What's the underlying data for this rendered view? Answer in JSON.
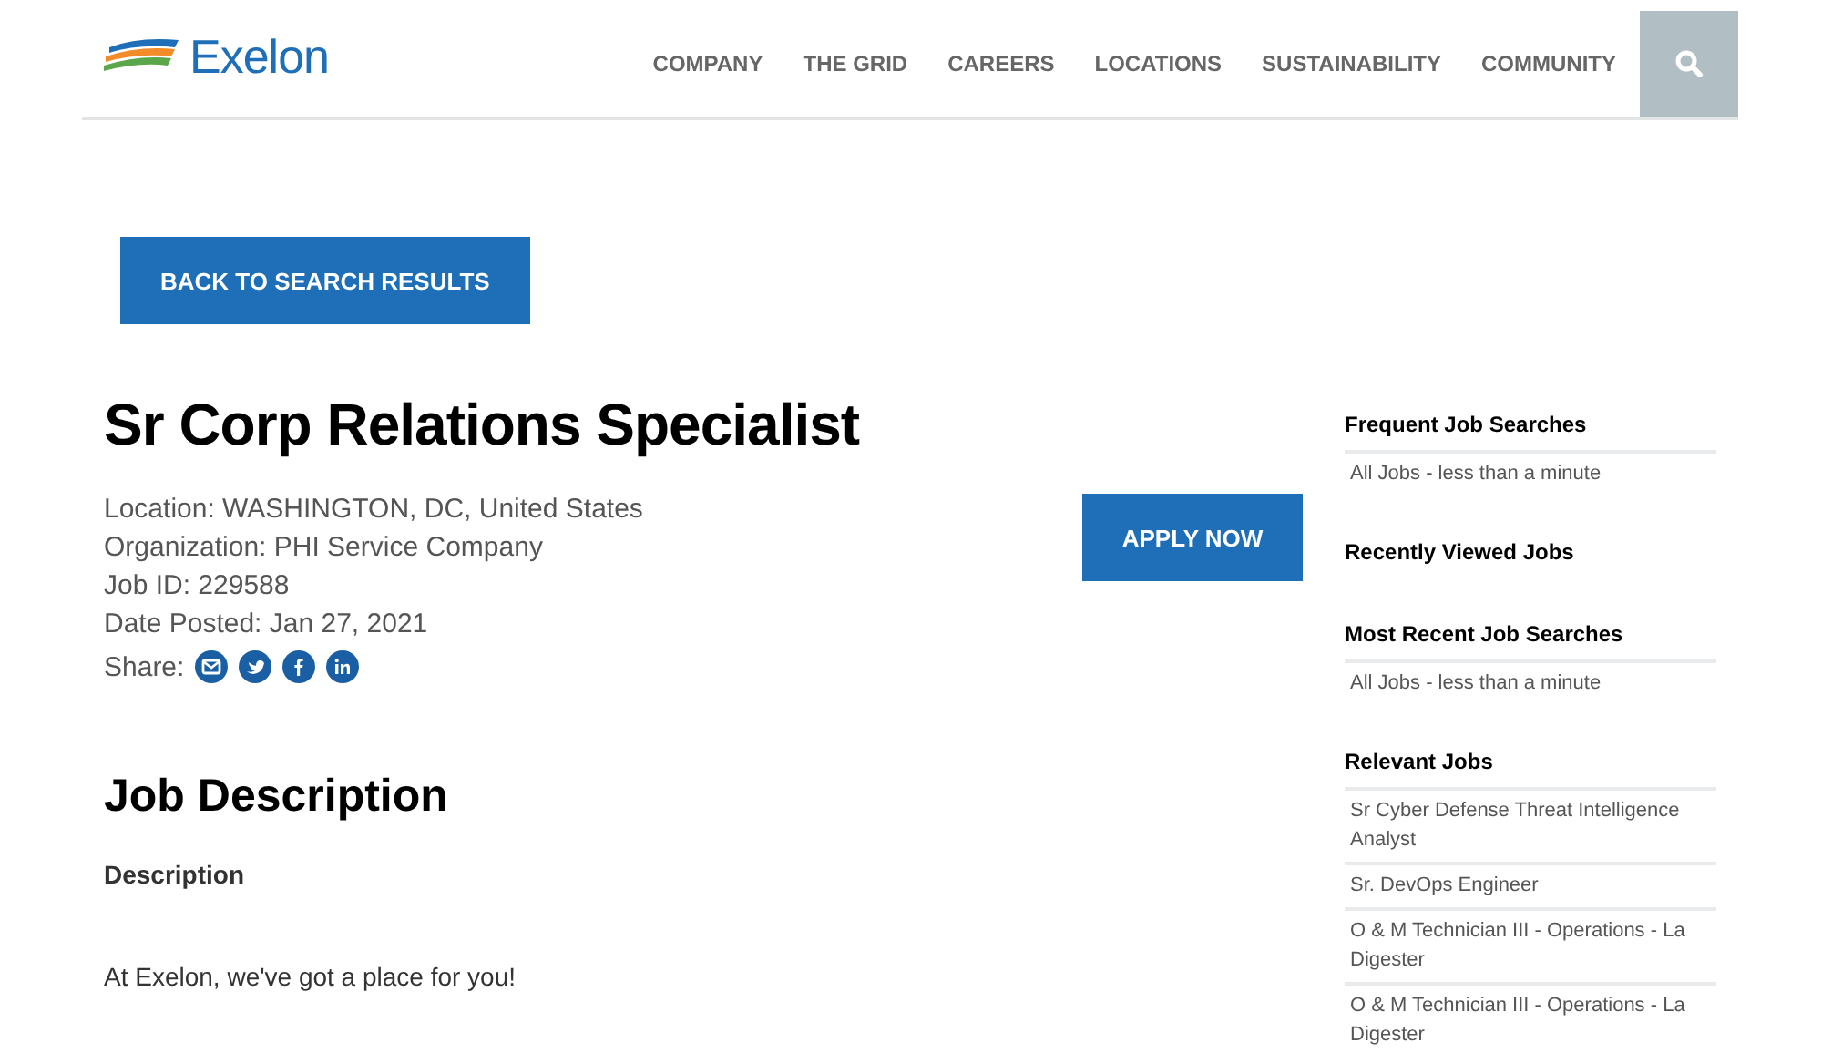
{
  "header": {
    "logo": "Exelon",
    "nav": [
      "COMPANY",
      "THE GRID",
      "CAREERS",
      "LOCATIONS",
      "SUSTAINABILITY",
      "COMMUNITY"
    ]
  },
  "back_button": "BACK TO SEARCH RESULTS",
  "job": {
    "title": "Sr Corp Relations Specialist",
    "details": [
      "Location: WASHINGTON, DC, United States",
      "Organization: PHI Service Company",
      "Job ID: 229588",
      "Date Posted: Jan 27, 2021"
    ],
    "share_label": "Share:",
    "share": [
      {
        "kind": "email"
      },
      {
        "kind": "twitter"
      },
      {
        "kind": "facebook"
      },
      {
        "kind": "linkedin"
      }
    ],
    "apply_button": "APPLY NOW"
  },
  "description": {
    "heading": "Job Description",
    "subheading": "Description",
    "text": "At Exelon, we've got a place for you!"
  },
  "sidebar": [
    {
      "heading": "Frequent Job Searches",
      "items": [
        "All Jobs - less than a minute"
      ]
    },
    {
      "heading": "Recently Viewed Jobs"
    },
    {
      "heading": "Most Recent Job Searches",
      "items": [
        "All Jobs - less than a minute"
      ]
    },
    {
      "heading": "Relevant Jobs",
      "items": [
        "Sr Cyber Defense Threat Intelligence Analyst",
        "Sr. DevOps Engineer",
        "O & M Technician III - Operations - La Digester",
        "O & M Technician III - Operations - La Digester"
      ]
    }
  ]
}
